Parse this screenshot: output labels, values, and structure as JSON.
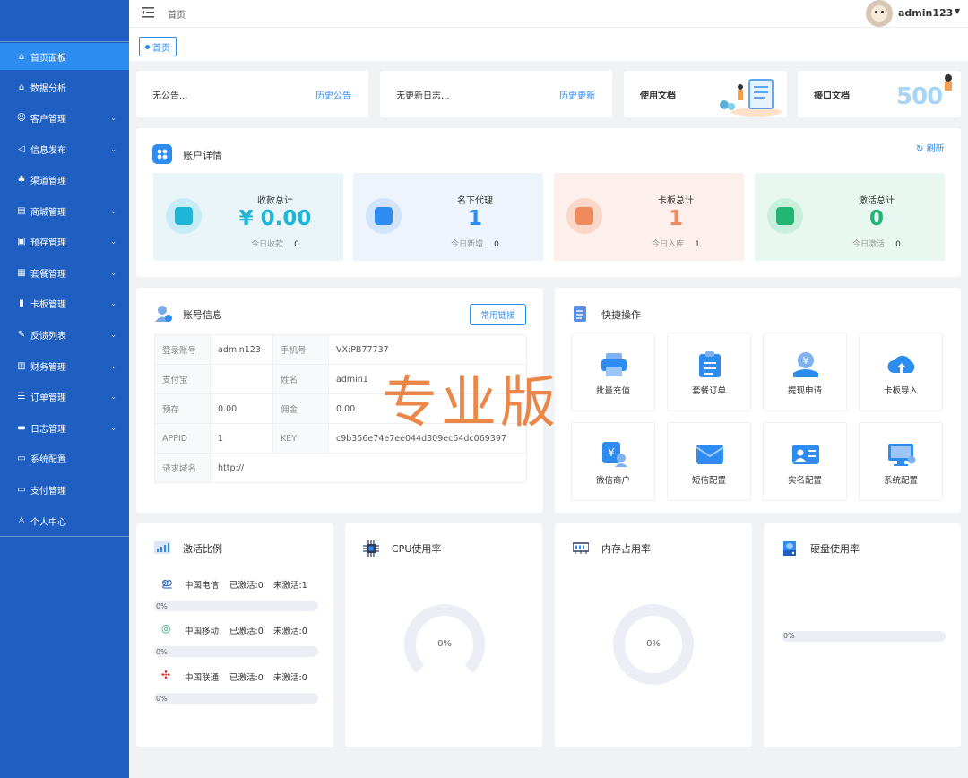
{
  "sidebar": {
    "items": [
      {
        "label": "首页面板",
        "icon": "home-icon",
        "expandable": false
      },
      {
        "label": "数据分析",
        "icon": "home-icon",
        "expandable": false
      },
      {
        "label": "客户管理",
        "icon": "users-icon",
        "expandable": true
      },
      {
        "label": "信息发布",
        "icon": "megaphone-icon",
        "expandable": true
      },
      {
        "label": "渠道管理",
        "icon": "tree-icon",
        "expandable": false
      },
      {
        "label": "商城管理",
        "icon": "store-icon",
        "expandable": true
      },
      {
        "label": "预存管理",
        "icon": "wallet-icon",
        "expandable": true
      },
      {
        "label": "套餐管理",
        "icon": "package-icon",
        "expandable": true
      },
      {
        "label": "卡板管理",
        "icon": "sim-card-icon",
        "expandable": true
      },
      {
        "label": "反馈列表",
        "icon": "feedback-icon",
        "expandable": true
      },
      {
        "label": "财务管理",
        "icon": "finance-icon",
        "expandable": true
      },
      {
        "label": "订单管理",
        "icon": "order-icon",
        "expandable": true
      },
      {
        "label": "日志管理",
        "icon": "log-icon",
        "expandable": true
      },
      {
        "label": "系统配置",
        "icon": "monitor-icon",
        "expandable": false
      },
      {
        "label": "支付管理",
        "icon": "card-icon",
        "expandable": false
      },
      {
        "label": "个人中心",
        "icon": "user-icon",
        "expandable": false
      }
    ]
  },
  "topbar": {
    "breadcrumb": "首页",
    "username": "admin123"
  },
  "tags": {
    "home": "首页"
  },
  "notices": {
    "announcement": "无公告...",
    "announcement_link": "历史公告",
    "changelog": "无更新日志...",
    "changelog_link": "历史更新",
    "docs": "使用文档",
    "api_docs": "接口文档",
    "api_badge": "500"
  },
  "account": {
    "title": "账户详情",
    "refresh": "刷新",
    "stats": [
      {
        "title": "收款总计",
        "value": "¥ 0.00",
        "sub_label": "今日收款",
        "sub_value": "0"
      },
      {
        "title": "名下代理",
        "value": "1",
        "sub_label": "今日新增",
        "sub_value": "0"
      },
      {
        "title": "卡板总计",
        "value": "1",
        "sub_label": "今日入库",
        "sub_value": "1"
      },
      {
        "title": "激活总计",
        "value": "0",
        "sub_label": "今日激活",
        "sub_value": "0"
      }
    ]
  },
  "info": {
    "title": "账号信息",
    "button": "常用链接",
    "login_label": "登录账号",
    "login": "admin123",
    "phone_label": "手机号",
    "phone": "VX:PB77737",
    "alipay_label": "支付宝",
    "alipay": "",
    "name_label": "姓名",
    "name": "admin1",
    "deposit_label": "预存",
    "deposit": "0.00",
    "commission_label": "佣金",
    "commission": "0.00",
    "appid_label": "APPID",
    "appid": "1",
    "key_label": "KEY",
    "key": "c9b356e74e7ee044d309ec64dc069397",
    "domain_label": "请求域名",
    "domain": "http://"
  },
  "quick": {
    "title": "快捷操作",
    "actions": [
      "批量充值",
      "套餐订单",
      "提现申请",
      "卡板导入",
      "微信商户",
      "短信配置",
      "实名配置",
      "系统配置"
    ]
  },
  "watermark": "专业版",
  "activation": {
    "title": "激活比例",
    "carriers": [
      {
        "name": "中国电信",
        "activated": "已激活:0",
        "inactive": "未激活:1",
        "percent_label": "0%",
        "percent": 0
      },
      {
        "name": "中国移动",
        "activated": "已激活:0",
        "inactive": "未激活:0",
        "percent_label": "0%",
        "percent": 0
      },
      {
        "name": "中国联通",
        "activated": "已激活:0",
        "inactive": "未激活:0",
        "percent_label": "0%",
        "percent": 0
      }
    ]
  },
  "cpu": {
    "title": "CPU使用率",
    "value": "0%"
  },
  "memory": {
    "title": "内存占用率",
    "value": "0%"
  },
  "disk": {
    "title": "硬盘使用率",
    "value": "0%",
    "percent": 0
  },
  "colors": {
    "sidebar": "#1f5fc2",
    "active": "#2d8cf0",
    "accent": "#2d8cf0",
    "cyan": "#1fb5d6",
    "orange": "#f08a5d",
    "green": "#22b573"
  }
}
